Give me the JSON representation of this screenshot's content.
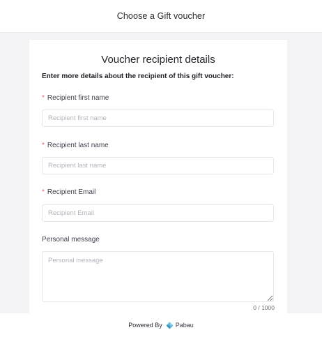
{
  "header": {
    "title": "Choose a Gift voucher"
  },
  "form": {
    "title": "Voucher recipient details",
    "intro": "Enter more details about the recipient of this gift voucher:",
    "required_marker": "*",
    "first_name": {
      "label": "Recipient first name",
      "placeholder": "Recipient first name",
      "value": ""
    },
    "last_name": {
      "label": "Recipient last name",
      "placeholder": "Recipient last name",
      "value": ""
    },
    "email": {
      "label": "Recipient Email",
      "placeholder": "Recipient Email",
      "value": ""
    },
    "message": {
      "label": "Personal message",
      "placeholder": "Personal message",
      "value": "",
      "counter": "0 / 1000"
    }
  },
  "footer": {
    "powered_by": "Powered By",
    "brand": "Pabau",
    "logo_icon": "pabau-logo-icon",
    "brand_color": "#54b2d3"
  }
}
